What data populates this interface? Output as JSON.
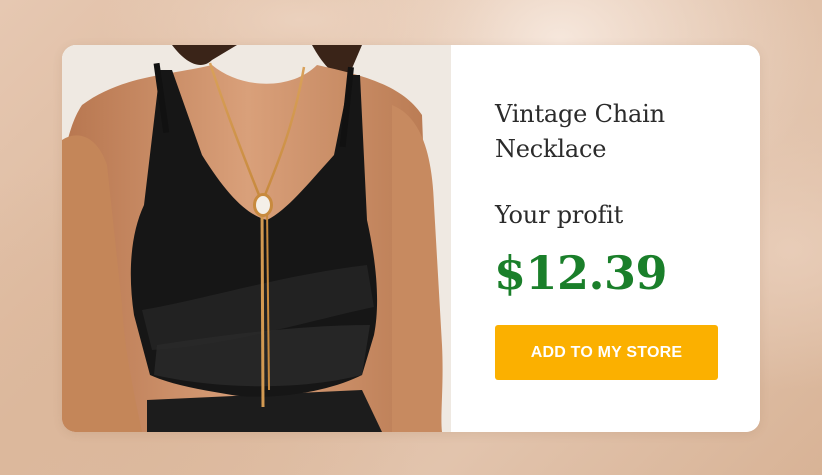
{
  "product": {
    "title": "Vintage Chain Necklace",
    "profit_label": "Your profit",
    "profit_value": "$12.39",
    "cta_label": "ADD TO MY STORE"
  },
  "colors": {
    "price": "#1a7f2a",
    "cta_background": "#fbb000",
    "cta_text": "#ffffff",
    "card_background": "#ffffff",
    "backdrop": "#dcb89c"
  },
  "image": {
    "subject": "model-wearing-black-top-and-gold-necklace"
  }
}
